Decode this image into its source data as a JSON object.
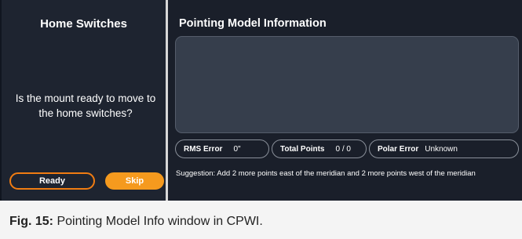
{
  "home_switches": {
    "title": "Home Switches",
    "question": "Is the mount ready to move to the home switches?",
    "ready_label": "Ready",
    "skip_label": "Skip"
  },
  "pointing_model": {
    "title": "Pointing Model Information",
    "rms_error_label": "RMS Error",
    "rms_error_value": "0\"",
    "total_points_label": "Total Points",
    "total_points_value": "0 / 0",
    "polar_error_label": "Polar Error",
    "polar_error_value": "Unknown",
    "suggestion": "Suggestion: Add 2 more points east of the meridian and 2 more points west of the meridian"
  },
  "caption": {
    "label": "Fig. 15:",
    "text": "Pointing Model Info window in CPWI."
  },
  "colors": {
    "accent_orange": "#f07c12",
    "skip_fill": "#f59a1e",
    "panel_dark": "#1e2430"
  }
}
